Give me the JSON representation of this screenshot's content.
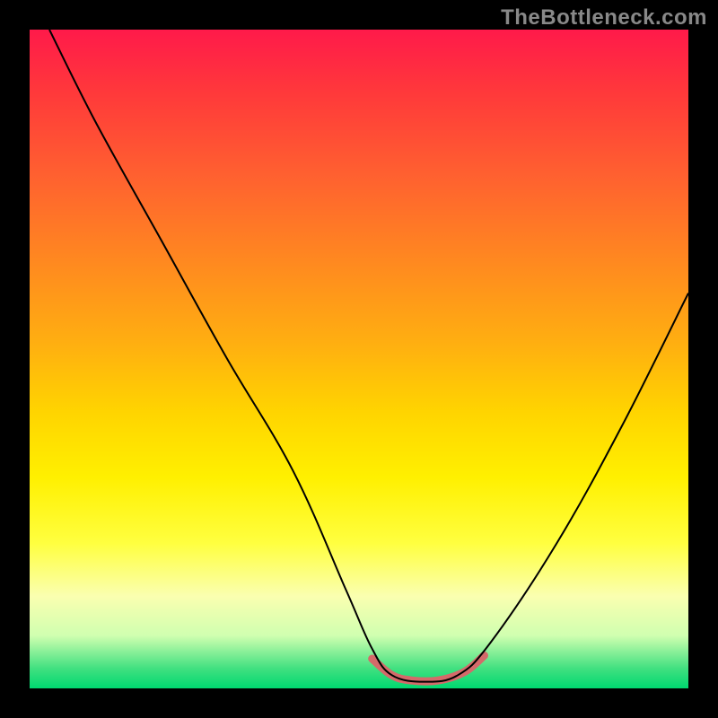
{
  "watermark": "TheBottleneck.com",
  "chart_data": {
    "type": "line",
    "title": "",
    "xlabel": "",
    "ylabel": "",
    "xlim": [
      0,
      100
    ],
    "ylim": [
      0,
      100
    ],
    "background_gradient": {
      "top_color": "#ff1a4a",
      "bottom_color": "#00d870",
      "description": "vertical gradient red-orange-yellow-green"
    },
    "series": [
      {
        "name": "main-curve",
        "color": "#000000",
        "stroke_width": 2,
        "x": [
          3,
          10,
          20,
          30,
          40,
          48,
          52,
          55,
          60,
          65,
          70,
          80,
          90,
          100
        ],
        "y": [
          100,
          86,
          68,
          50,
          33,
          15,
          6,
          2,
          1,
          2,
          7,
          22,
          40,
          60
        ]
      },
      {
        "name": "valley-highlight",
        "color": "#d46a6a",
        "stroke_width": 9,
        "x": [
          52,
          55,
          58,
          62,
          66,
          69
        ],
        "y": [
          4.5,
          2,
          1.2,
          1.2,
          2.5,
          5
        ]
      }
    ]
  }
}
